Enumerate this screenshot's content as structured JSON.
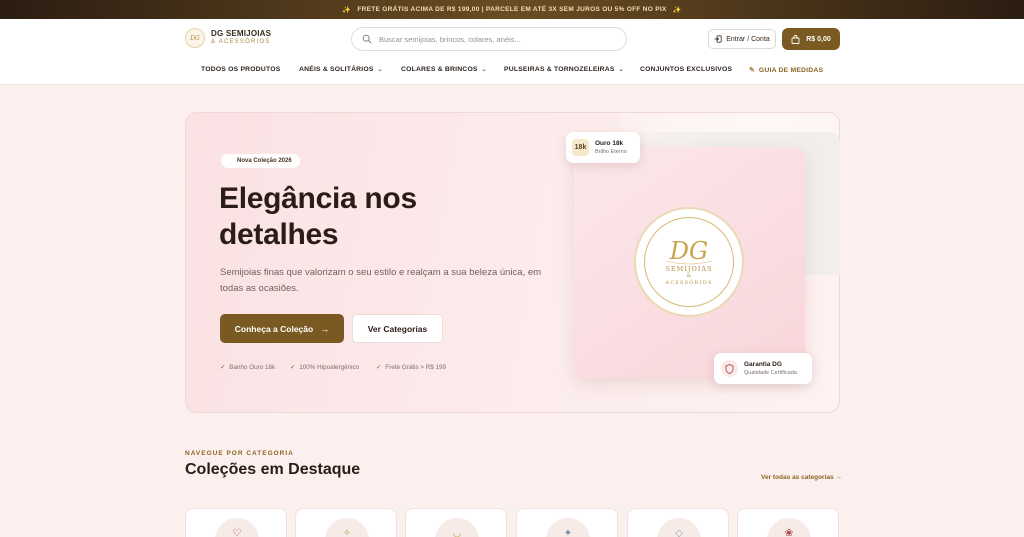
{
  "announcement": {
    "text": "FRETE GRÁTIS ACIMA DE R$ 199,00 | PARCELE EM ATÉ 3X SEM JUROS OU 5% OFF NO PIX",
    "spark": "✨"
  },
  "brand": {
    "badge": "DG",
    "name_line1": "DG SEMIJOIAS",
    "name_line2": "& ACESSÓRIOS"
  },
  "search": {
    "placeholder": "Buscar semijoias, brincos, colares, anéis..."
  },
  "header_actions": {
    "account_label": "Entrar / Conta",
    "cart_label": "R$ 0,00"
  },
  "nav": {
    "items": [
      {
        "label": "TODOS OS PRODUTOS"
      },
      {
        "label": "ANÉIS & SOLITÁRIOS",
        "chevron": "⌄"
      },
      {
        "label": "COLARES & BRINCOS",
        "chevron": "⌄"
      },
      {
        "label": "PULSEIRAS & TORNOZELEIRAS",
        "chevron": "⌄"
      },
      {
        "label": "CONJUNTOS EXCLUSIVOS"
      },
      {
        "label": "GUIA DE MEDIDAS",
        "icon": "✎"
      }
    ]
  },
  "hero": {
    "pill": "Nova Coleção 2026",
    "title": "Elegância nos detalhes",
    "subtitle": "Semijoias finas que valorizam o seu estilo e realçam a sua beleza única, em todas as ocasiões.",
    "primary_cta": "Conheça a Coleção",
    "primary_arrow": "→",
    "secondary_cta": "Ver Categorias",
    "perks": [
      {
        "check": "✓",
        "text": "Banho Ouro 18k"
      },
      {
        "check": "✓",
        "text": "100% Hipoalergênico"
      },
      {
        "check": "✓",
        "text": "Frete Grátis > R$ 199"
      }
    ],
    "gold_tag": {
      "badge": "18k",
      "title": "Ouro 18k",
      "subtitle": "Brilho Eterno"
    },
    "guarantee_tag": {
      "title": "Garantia DG",
      "subtitle": "Qualidade Certificada"
    },
    "seal": {
      "monogram": "DG",
      "line1": "SEMIJOIAS",
      "line2": "&",
      "line3": "ACESSÓRIOS"
    }
  },
  "categories": {
    "eyebrow": "NAVEGUE POR CATEGORIA",
    "title": "Coleções em Destaque",
    "see_all": "Ver todas as categorias →",
    "items": [
      {
        "icon": "ring-icon",
        "glyph": "♡",
        "color": "#b0443f"
      },
      {
        "icon": "earring-icon",
        "glyph": "✧",
        "color": "#c9a24a"
      },
      {
        "icon": "necklace-icon",
        "glyph": "◡",
        "color": "#c9a24a"
      },
      {
        "icon": "bracelet-icon",
        "glyph": "✦",
        "color": "#6c8fb0"
      },
      {
        "icon": "anklet-icon",
        "glyph": "◇",
        "color": "#9aa3b0"
      },
      {
        "icon": "set-icon",
        "glyph": "❀",
        "color": "#b0443f"
      }
    ]
  },
  "colors": {
    "brand_gold": "#7a5a22",
    "accent_gold": "#8a6526",
    "hero_pink": "#fbe1e3"
  }
}
